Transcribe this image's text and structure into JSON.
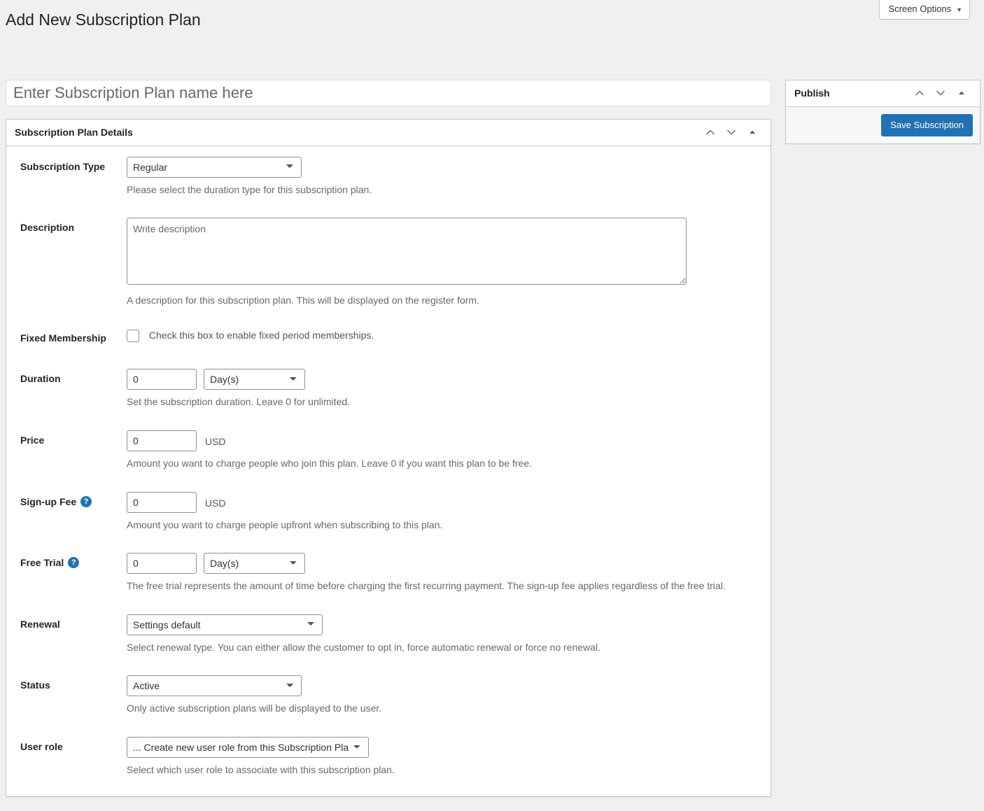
{
  "screen_options": {
    "label": "Screen Options",
    "caret": "▼"
  },
  "page": {
    "title": "Add New Subscription Plan"
  },
  "title_field": {
    "value": "",
    "placeholder": "Enter Subscription Plan name here"
  },
  "metabox": {
    "title": "Subscription Plan Details",
    "move_up_title": "Move up",
    "move_down_title": "Move down",
    "toggle_title": "Toggle panel"
  },
  "publish_box": {
    "title": "Publish",
    "move_up_title": "Move up",
    "move_down_title": "Move down",
    "toggle_title": "Toggle panel",
    "save_label": "Save Subscription"
  },
  "fields": {
    "subscription_type": {
      "label": "Subscription Type",
      "value": "Regular",
      "options": [
        "Regular"
      ],
      "description": "Please select the duration type for this subscription plan."
    },
    "description": {
      "label": "Description",
      "value": "",
      "placeholder": "Write description",
      "description": "A description for this subscription plan. This will be displayed on the register form."
    },
    "fixed_membership": {
      "label": "Fixed Membership",
      "checkbox_label": "Check this box to enable fixed period memberships.",
      "checked": false
    },
    "duration": {
      "label": "Duration",
      "value": "0",
      "period": "Day(s)",
      "period_options": [
        "Day(s)"
      ],
      "description": "Set the subscription duration. Leave 0 for unlimited."
    },
    "price": {
      "label": "Price",
      "value": "0",
      "currency": "USD",
      "description": "Amount you want to charge people who join this plan. Leave 0 if you want this plan to be free."
    },
    "signup_fee": {
      "label": "Sign-up Fee",
      "help": "?",
      "value": "0",
      "currency": "USD",
      "description": "Amount you want to charge people upfront when subscribing to this plan."
    },
    "free_trial": {
      "label": "Free Trial",
      "help": "?",
      "value": "0",
      "period": "Day(s)",
      "period_options": [
        "Day(s)"
      ],
      "description": "The free trial represents the amount of time before charging the first recurring payment. The sign-up fee applies regardless of the free trial."
    },
    "renewal": {
      "label": "Renewal",
      "value": "Settings default",
      "options": [
        "Settings default"
      ],
      "description": "Select renewal type. You can either allow the customer to opt in, force automatic renewal or force no renewal."
    },
    "status": {
      "label": "Status",
      "value": "Active",
      "options": [
        "Active"
      ],
      "description": "Only active subscription plans will be displayed to the user."
    },
    "user_role": {
      "label": "User role",
      "value": "... Create new user role from this Subscription Plan",
      "options": [
        "... Create new user role from this Subscription Plan"
      ],
      "description": "Select which user role to associate with this subscription plan."
    }
  },
  "colors": {
    "accent": "#2271b1",
    "page_bg": "#f0f0f1",
    "border": "#c3c4c7",
    "text": "#3c434a",
    "muted": "#646970"
  }
}
